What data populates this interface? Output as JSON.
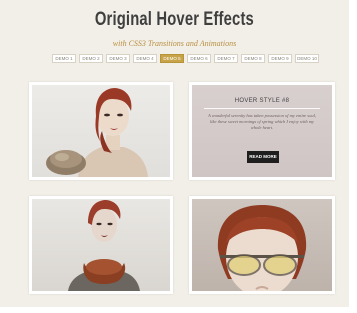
{
  "header": {
    "title": "Original Hover Effects",
    "subtitle": "with CSS3 Transitions and Animations"
  },
  "nav": {
    "demos": [
      "DEMO 1",
      "DEMO 2",
      "DEMO 3",
      "DEMO 4",
      "DEMO 5",
      "DEMO 6",
      "DEMO 7",
      "DEMO 8",
      "DEMO 9",
      "DEMO 10"
    ],
    "active_index": 4
  },
  "grid": {
    "hover_cell": {
      "title": "HOVER STYLE #8",
      "text": "A wonderful serenity has taken possession of my entire soul, like these sweet mornings of spring which I enjoy with my whole heart.",
      "button": "READ MORE"
    }
  },
  "colors": {
    "accent": "#c7a34a",
    "subtitle": "#b98f40",
    "background": "#f2efe8"
  }
}
